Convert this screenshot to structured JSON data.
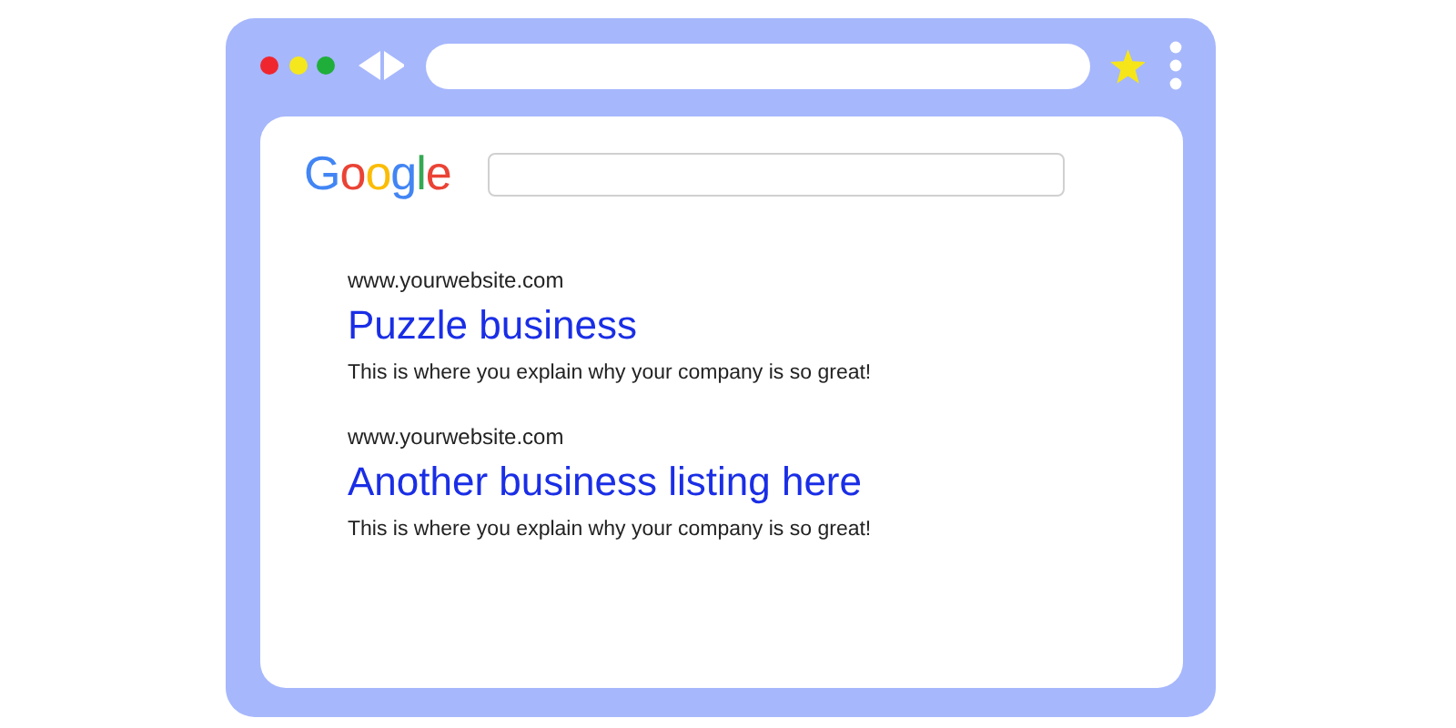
{
  "search_page": {
    "logo": "Google"
  },
  "results": [
    {
      "url": "www.yourwebsite.com",
      "title": "Puzzle business",
      "description": "This is where you explain why your company is so great!"
    },
    {
      "url": "www.yourwebsite.com",
      "title": "Another business listing here",
      "description": "This is where you explain why your company is so great!"
    }
  ]
}
